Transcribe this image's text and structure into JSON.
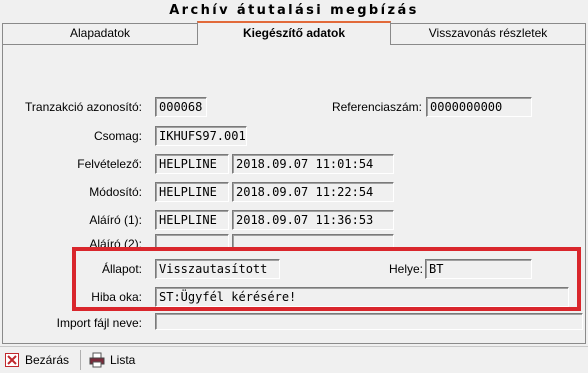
{
  "window": {
    "title": "Archív átutalási megbízás"
  },
  "tabs": [
    {
      "label": "Alapadatok"
    },
    {
      "label": "Kiegészítő adatok"
    },
    {
      "label": "Visszavonás részletek"
    }
  ],
  "form": {
    "tranzakcio": {
      "label": "Tranzakció azonosító:",
      "value": "000068"
    },
    "referencia": {
      "label": "Referenciaszám:",
      "value": "0000000000"
    },
    "csomag": {
      "label": "Csomag:",
      "value": "IKHUFS97.001"
    },
    "felvetelezo": {
      "label": "Felvételező:",
      "user": "HELPLINE",
      "time": "2018.09.07 11:01:54"
    },
    "modosito": {
      "label": "Módosító:",
      "user": "HELPLINE",
      "time": "2018.09.07 11:22:54"
    },
    "alairo1": {
      "label": "Aláíró (1):",
      "user": "HELPLINE",
      "time": "2018.09.07 11:36:53"
    },
    "alairo2": {
      "label": "Aláíró (2):",
      "user": "",
      "time": ""
    },
    "allapot": {
      "label": "Állapot:",
      "value": "Visszautasított"
    },
    "helye": {
      "label": "Helye:",
      "value": "BT"
    },
    "hiba_oka": {
      "label": "Hiba oka:",
      "value": "ST:Ügyfél kérésére!"
    },
    "import": {
      "label": "Import fájl neve:",
      "value": ""
    }
  },
  "toolbar": {
    "close_label": "Bezárás",
    "list_label": "Lista"
  },
  "colors": {
    "tab_accent": "#e26a3a",
    "highlight": "#d9262c",
    "close_icon": "#c0282d"
  }
}
